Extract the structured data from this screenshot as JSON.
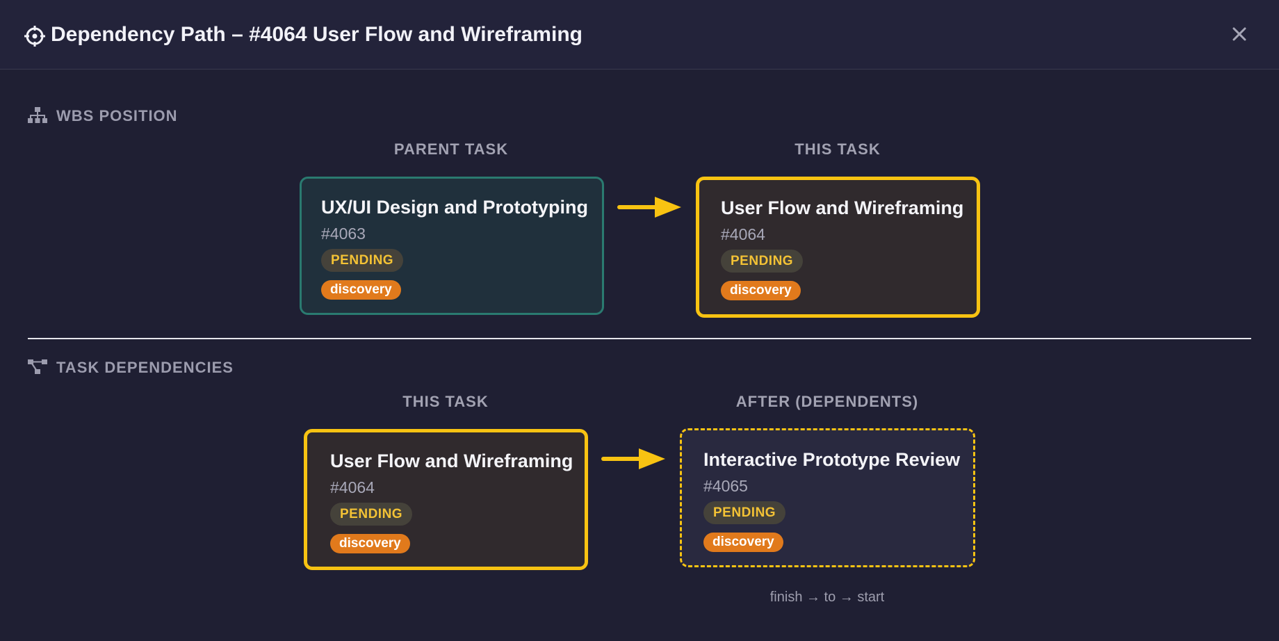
{
  "dialog": {
    "title": "Dependency Path – #4064 User Flow and Wireframing",
    "header_icon": "crosshair-icon",
    "close_icon": "close-icon"
  },
  "wbs": {
    "heading": "WBS POSITION",
    "icon": "hierarchy-icon",
    "parent_label": "PARENT TASK",
    "this_label": "THIS TASK",
    "parent": {
      "title": "UX/UI Design and Prototyping",
      "id": "#4063",
      "status": "PENDING",
      "tag": "discovery"
    },
    "current": {
      "title": "User Flow and Wireframing",
      "id": "#4064",
      "status": "PENDING",
      "tag": "discovery"
    }
  },
  "deps": {
    "heading": "TASK DEPENDENCIES",
    "icon": "dependency-graph-icon",
    "this_label": "THIS TASK",
    "after_label": "AFTER (DEPENDENTS)",
    "current": {
      "title": "User Flow and Wireframing",
      "id": "#4064",
      "status": "PENDING",
      "tag": "discovery"
    },
    "dependent": {
      "title": "Interactive Prototype Review",
      "id": "#4065",
      "status": "PENDING",
      "tag": "discovery"
    },
    "relation_note": "finish → to → start"
  },
  "colors": {
    "background": "#1f1f33",
    "accent_yellow": "#f8c312",
    "parent_border": "#2a7a70",
    "tag_orange": "#e17a1c",
    "status_text": "#f3c235"
  }
}
